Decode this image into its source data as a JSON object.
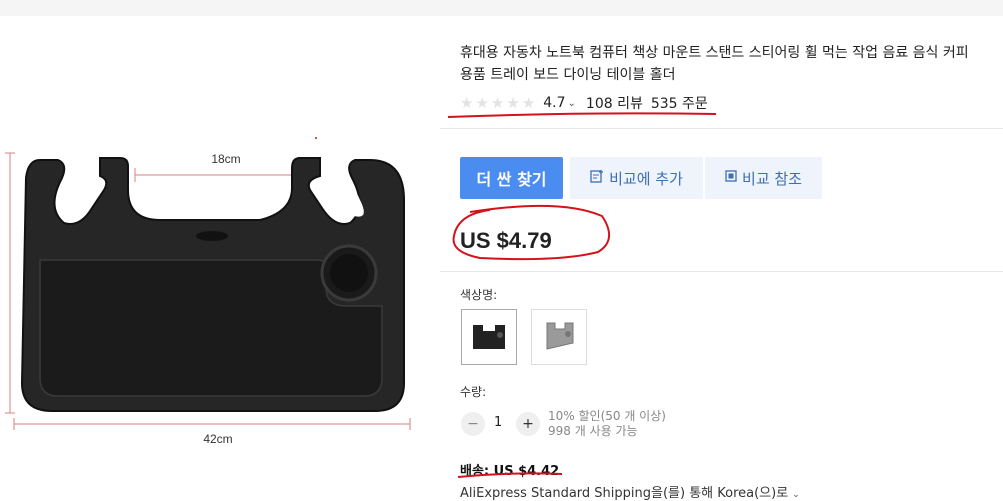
{
  "product": {
    "title_line1": "휴대용 자동차 노트북 컴퓨터 책상 마운트 스탠드 스티어링 휠 먹는 작업 음료 음식 커피",
    "title_line2": "용품 트레이 보드 다이닝 테이블 홀더",
    "image": {
      "label_width_top": "18cm",
      "label_width_bottom": "42cm"
    }
  },
  "rating": {
    "score": "4.7",
    "reviews": "108 리뷰",
    "orders": "535 주문"
  },
  "actions": {
    "find_cheaper": "더 싼 찾기",
    "add_compare": "비교에 추가",
    "view_compare": "비교 참조"
  },
  "price": {
    "current": "US $4.79"
  },
  "color": {
    "label": "색상명:",
    "options": [
      "black",
      "gray"
    ],
    "selected": "black"
  },
  "quantity": {
    "label": "수량:",
    "minus": "−",
    "plus": "+",
    "value": "1",
    "discount": "10% 할인(50 개 이상)",
    "available": "998 개 사용 가능"
  },
  "shipping": {
    "label": "배송: US $4.42",
    "method": "AliExpress Standard Shipping을(를) 통해 Korea(으)로"
  },
  "colors": {
    "primary_button": "#4a8cf0",
    "secondary_button": "#eef3fc",
    "annotation_red": "#d4121b"
  },
  "icons": {
    "add_compare": "compare-add-icon",
    "view_compare": "compare-view-icon",
    "rating": "star-icon",
    "dropdown": "chevron-down-icon"
  }
}
